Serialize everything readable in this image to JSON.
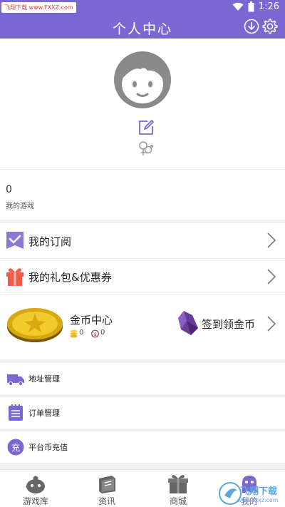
{
  "status_bar": {
    "time": "1:26",
    "watermark": "飞翔下载 www.FXXZ.com"
  },
  "header": {
    "title": "个人中心"
  },
  "games": {
    "count": "0",
    "label": "我的游戏"
  },
  "menu": {
    "subscriptions": "我的订阅",
    "gifts": "我的礼包&优惠券"
  },
  "coin_center": {
    "title": "金币中心",
    "gold_count": "0",
    "platform_count": "0",
    "checkin_label": "签到领金币"
  },
  "sub_menu": {
    "address": "地址管理",
    "orders": "订单管理",
    "recharge": "平台币充值",
    "recharge_icon_char": "充"
  },
  "bottom_nav": {
    "games": "游戏库",
    "news": "资讯",
    "store": "商城",
    "me": "我的"
  },
  "watermark_bottom": {
    "title": "飞翔下载",
    "url": "www.fxxz.com"
  },
  "colors": {
    "brand": "#7b67d1",
    "gift": "#ef5b4c",
    "coin": "#f0c020",
    "gem": "#6a3c9a"
  },
  "icons": [
    "wifi-icon",
    "battery-icon",
    "download-icon",
    "gear-icon",
    "avatar-icon",
    "edit-icon",
    "gender-icon",
    "subscription-icon",
    "gift-icon",
    "chevron-right-icon",
    "gold-coin-icon",
    "gem-icon",
    "truck-icon",
    "order-list-icon",
    "recharge-icon",
    "game-pad-icon",
    "book-icon",
    "shop-icon",
    "monster-icon"
  ]
}
